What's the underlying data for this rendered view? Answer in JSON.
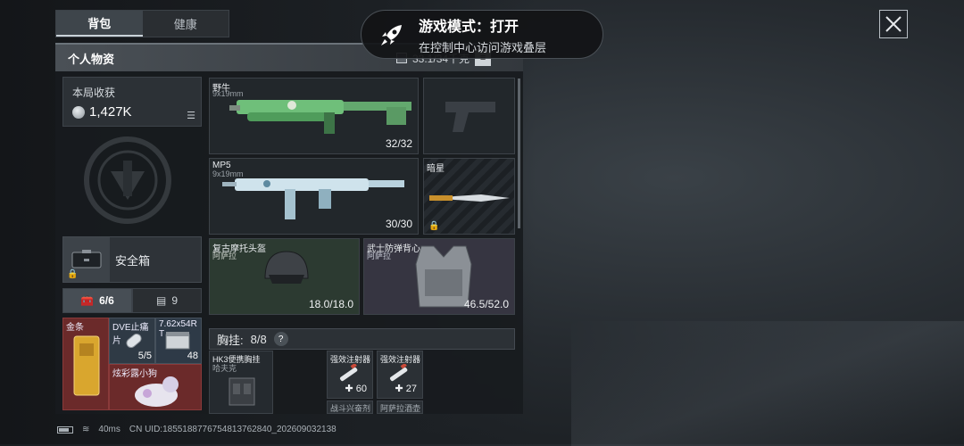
{
  "tabs": [
    {
      "label": "背包"
    },
    {
      "label": "健康"
    }
  ],
  "section": {
    "title": "个人物资",
    "capacity": "33.1/34千克"
  },
  "earnings": {
    "label": "本局收获",
    "value": "1,427K"
  },
  "safebox": {
    "label": "安全箱"
  },
  "left_tabs": [
    {
      "label": "6/6"
    },
    {
      "label": "9"
    }
  ],
  "mini_items": [
    {
      "name": "金条",
      "count": ""
    },
    {
      "name": "DVE止痛片",
      "count": "5/5"
    },
    {
      "name": "7.62x54R T",
      "count": "48"
    },
    {
      "name": "炫彩露小狗",
      "count": ""
    }
  ],
  "weapons": [
    {
      "name": "野牛",
      "caliber": "9x19mm",
      "ammo": "32/32"
    },
    {
      "name": "MP5",
      "caliber": "9x19mm",
      "ammo": "30/30"
    },
    {
      "name": "暗星",
      "caliber": "",
      "ammo": ""
    }
  ],
  "armor": [
    {
      "name": "复古摩托头盔",
      "maker": "阿萨拉",
      "durability": "18.0/18.0"
    },
    {
      "name": "武士防弹背心",
      "maker": "阿萨拉",
      "durability": "46.5/52.0"
    }
  ],
  "chest_rig": {
    "label": "胸挂:",
    "count": "8/8",
    "help": "?"
  },
  "chest_items": [
    {
      "name": "HK3便携胸挂",
      "maker": "哈夫克"
    },
    {
      "name": "强效注射器",
      "count": "60"
    },
    {
      "name": "强效注射器",
      "count": "27"
    }
  ],
  "bottom_items": [
    {
      "name": "战斗兴奋剂"
    },
    {
      "name": "阿萨拉酒壶"
    }
  ],
  "toast": {
    "title": "游戏模式：打开",
    "subtitle": "在控制中心访问游戏叠层"
  },
  "status": {
    "ping": "40ms",
    "uid": "CN UID:1855188776754813762840_202609032138"
  },
  "colors": {
    "accent": "#c9d2d8",
    "gold": "#d9a62e",
    "rare_red": "#6b2a2a",
    "green_slot": "#2c3a31",
    "purple_slot": "#363541"
  }
}
